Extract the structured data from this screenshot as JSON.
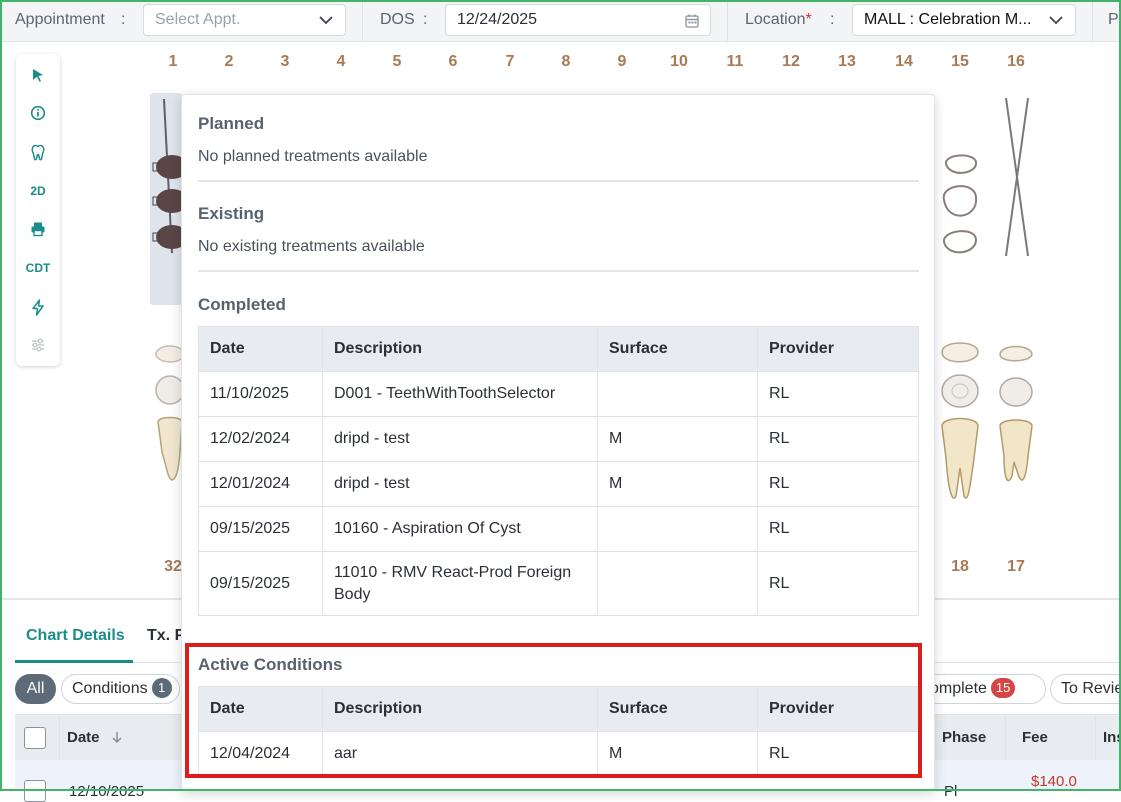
{
  "topbar": {
    "appointment_label": "Appointment",
    "appointment_colon": ":",
    "appointment_placeholder": "Select Appt.",
    "dos_label": "DOS",
    "dos_colon": ":",
    "dos_value": "12/24/2025",
    "location_label": "Location",
    "location_required": "*",
    "location_colon": ":",
    "location_value": "MALL : Celebration M...",
    "next_label": "P"
  },
  "tooth_numbers_top": [
    "1",
    "2",
    "3",
    "4",
    "5",
    "6",
    "7",
    "8",
    "9",
    "10",
    "11",
    "12",
    "13",
    "14",
    "15",
    "16"
  ],
  "tooth_numbers_bottom_visible": {
    "left": "32",
    "right_a": "18",
    "right_b": "17"
  },
  "toolbar": {
    "tools": [
      {
        "name": "pointer-icon",
        "label": ""
      },
      {
        "name": "info-icon",
        "label": ""
      },
      {
        "name": "tooth-icon",
        "label": ""
      },
      {
        "name": "2d-view",
        "label": "2D"
      },
      {
        "name": "print-icon",
        "label": ""
      },
      {
        "name": "cdt-tool",
        "label": "CDT"
      },
      {
        "name": "lightning-icon",
        "label": ""
      },
      {
        "name": "sliders-icon",
        "label": ""
      }
    ],
    "accent": "#1a8c8a"
  },
  "tabs": {
    "chart_details": "Chart Details",
    "tx_plan": "Tx. P"
  },
  "filters": {
    "all": "All",
    "conditions": "Conditions",
    "conditions_count": "1",
    "complete": "omplete",
    "complete_count": "15",
    "to_review": "To Revie"
  },
  "table": {
    "date_header": "Date",
    "phase_header": "Phase",
    "fee_header": "Fee",
    "ins_header": "Ins",
    "row_fee": "$140.0",
    "row_phase": "Pl",
    "row_date": "12/10/2025"
  },
  "popover": {
    "planned_title": "Planned",
    "planned_empty": "No planned treatments available",
    "existing_title": "Existing",
    "existing_empty": "No existing treatments available",
    "completed_title": "Completed",
    "columns": {
      "date": "Date",
      "description": "Description",
      "surface": "Surface",
      "provider": "Provider"
    },
    "completed_rows": [
      {
        "date": "11/10/2025",
        "description": "D001 - TeethWithToothSelector",
        "surface": "",
        "provider": "RL"
      },
      {
        "date": "12/02/2024",
        "description": "dripd - test",
        "surface": "M",
        "provider": "RL"
      },
      {
        "date": "12/01/2024",
        "description": "dripd - test",
        "surface": "M",
        "provider": "RL"
      },
      {
        "date": "09/15/2025",
        "description": "10160 - Aspiration Of Cyst",
        "surface": "",
        "provider": "RL"
      },
      {
        "date": "09/15/2025",
        "description": "11010 - RMV React-Prod Foreign Body",
        "surface": "",
        "provider": "RL"
      }
    ],
    "active_title": "Active Conditions",
    "active_rows": [
      {
        "date": "12/04/2024",
        "description": "aar",
        "surface": "M",
        "provider": "RL"
      }
    ]
  },
  "colors": {
    "accent": "#1a8c8a",
    "highlight": "#dd1c1c",
    "badge_red": "#d64545",
    "badge_gray": "#5d6a78",
    "frame": "#43b36a"
  }
}
